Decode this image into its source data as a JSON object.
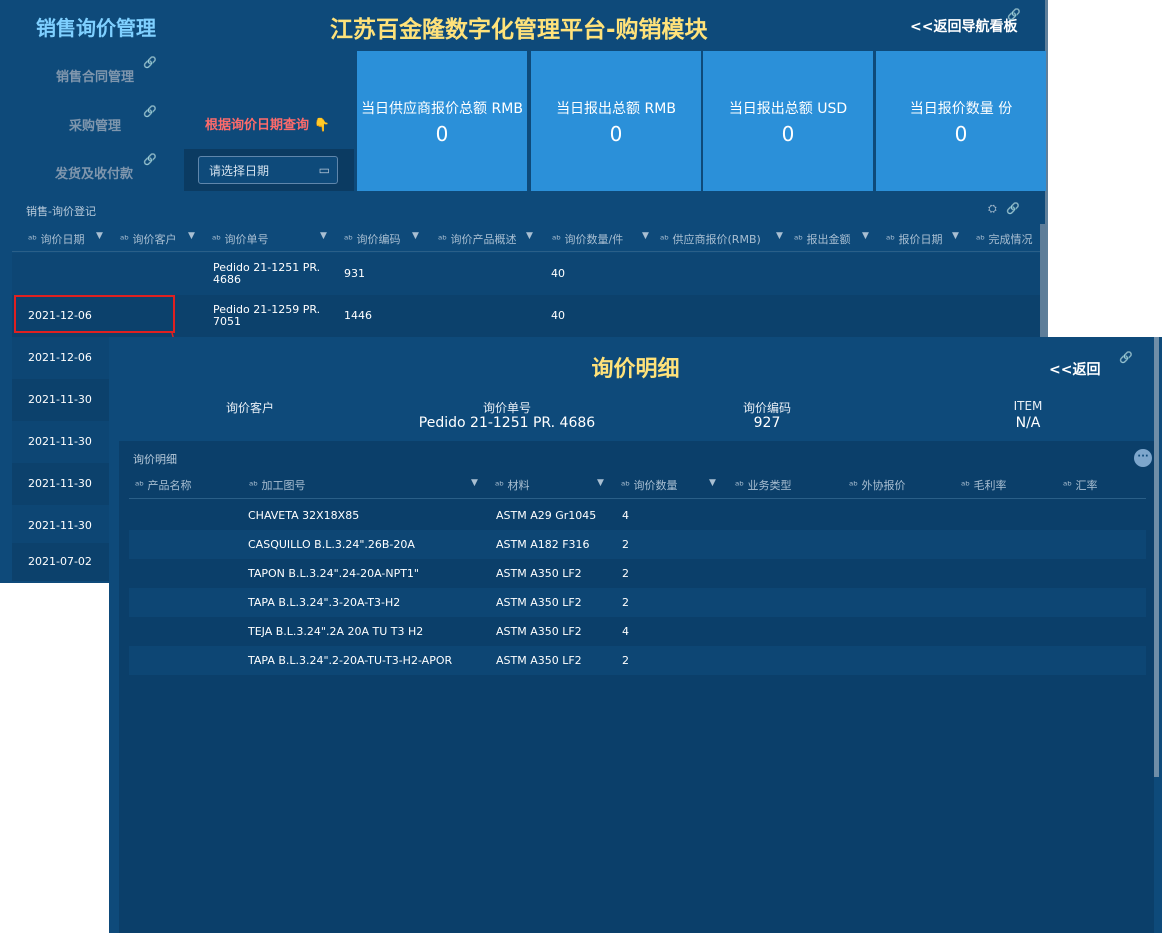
{
  "header": {
    "app_title": "销售询价管理",
    "platform_title": "江苏百金隆数字化管理平台-购销模块",
    "back_nav": "<<返回导航看板",
    "link_icon": "link-icon"
  },
  "sidebar": {
    "items": [
      {
        "label": "销售合同管理"
      },
      {
        "label": "采购管理"
      },
      {
        "label": "发货及收付款"
      }
    ]
  },
  "query": {
    "label": "根据询价日期查询",
    "date_placeholder": "请选择日期",
    "calendar_icon": "calendar-icon"
  },
  "kpis": [
    {
      "label": "当日供应商报价总额 RMB",
      "value": "0"
    },
    {
      "label": "当日报出总额 RMB",
      "value": "0"
    },
    {
      "label": "当日报出总额 USD",
      "value": "0"
    },
    {
      "label": "当日报价数量 份",
      "value": "0"
    }
  ],
  "inquiry_table": {
    "title": "销售-询价登记",
    "columns": [
      "询价日期",
      "询价客户",
      "询价单号",
      "询价编码",
      "询价产品概述",
      "询价数量/件",
      "供应商报价(RMB)",
      "报出金额",
      "报价日期",
      "完成情况"
    ],
    "rows": [
      {
        "date": "",
        "order_no": "Pedido 21-1251 PR. 4686",
        "code": "931",
        "qty": "40"
      },
      {
        "date": "2021-12-06",
        "order_no": "Pedido 21-1259 PR. 7051",
        "code": "1446",
        "qty": "40"
      }
    ],
    "more_dates": [
      "2021-12-06",
      "2021-11-30",
      "2021-11-30",
      "2021-11-30",
      "2021-11-30",
      "2021-07-02"
    ]
  },
  "detail": {
    "title": "询价明细",
    "back": "<<返回",
    "info": [
      {
        "label": "询价客户",
        "value": ""
      },
      {
        "label": "询价单号",
        "value": "Pedido 21-1251 PR. 4686"
      },
      {
        "label": "询价编码",
        "value": "927"
      },
      {
        "label": "ITEM",
        "value": "N/A"
      }
    ],
    "panel_title": "询价明细",
    "more_label": "···",
    "columns": [
      "产品名称",
      "加工图号",
      "材料",
      "询价数量",
      "业务类型",
      "外协报价",
      "毛利率",
      "汇率"
    ],
    "rows": [
      {
        "product": "",
        "drawing": "CHAVETA 32X18X85",
        "material": "ASTM A29 Gr1045",
        "qty": "4"
      },
      {
        "product": "",
        "drawing": "CASQUILLO B.L.3.24\".26B-20A",
        "material": "ASTM A182 F316",
        "qty": "2"
      },
      {
        "product": "",
        "drawing": "TAPON B.L.3.24\".24-20A-NPT1\"",
        "material": "ASTM A350 LF2",
        "qty": "2"
      },
      {
        "product": "",
        "drawing": "TAPA B.L.3.24\".3-20A-T3-H2",
        "material": "ASTM A350 LF2",
        "qty": "2"
      },
      {
        "product": "",
        "drawing": "TEJA B.L.3.24\".2A 20A TU T3 H2",
        "material": "ASTM A350 LF2",
        "qty": "4"
      },
      {
        "product": "",
        "drawing": "TAPA B.L.3.24\".2-20A-TU-T3-H2-APOR",
        "material": "ASTM A350 LF2",
        "qty": "2"
      }
    ]
  }
}
